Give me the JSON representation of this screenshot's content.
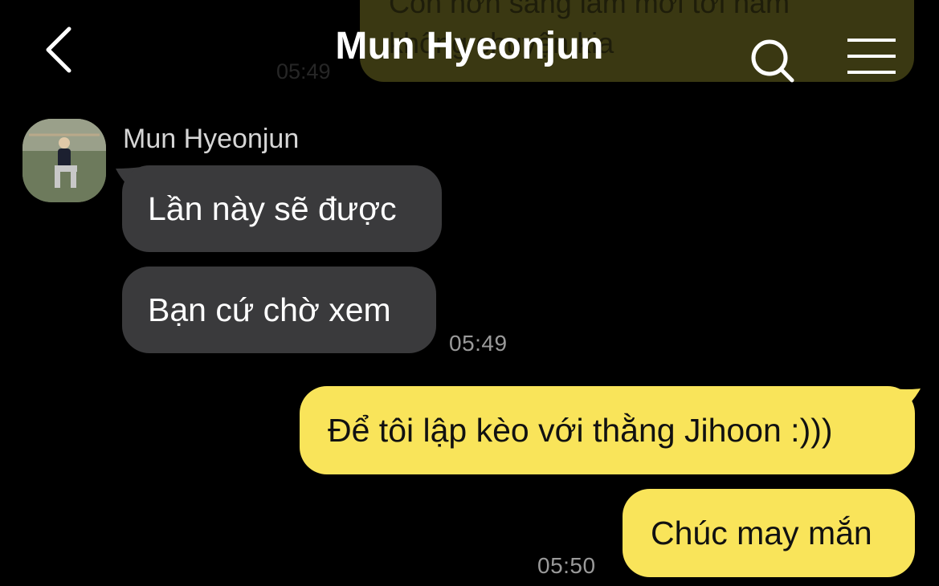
{
  "header": {
    "title": "Mun Hyeonjun",
    "back_icon": "chevron-left-icon",
    "search_icon": "search-icon",
    "menu_icon": "menu-icon"
  },
  "previous_message": {
    "line1": "Còn hơn sáng làm mới tới nằm",
    "line2": "không chuyện kia",
    "time": "05:49"
  },
  "incoming": {
    "sender": "Mun Hyeonjun",
    "messages": [
      "Lần này sẽ được",
      "Bạn cứ chờ xem"
    ],
    "time": "05:49"
  },
  "outgoing": {
    "messages": [
      "Để tôi lập kèo với thằng Jihoon :)))",
      "Chúc may mắn"
    ],
    "time": "05:50"
  },
  "colors": {
    "background": "#000000",
    "incoming_bubble": "#3a3a3c",
    "outgoing_bubble": "#f9e45a"
  }
}
